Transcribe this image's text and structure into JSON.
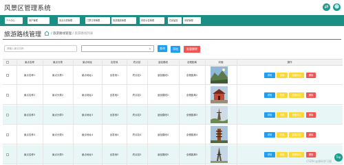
{
  "app": {
    "title": "风景区管理系统"
  },
  "nav": [
    "个人中心",
    "用户管理",
    "景点分类管理",
    "门票订单管理",
    "旅游路线管理",
    "系统公告管理",
    "在线留言",
    "系统管理"
  ],
  "page": {
    "title": "旅游路线管理",
    "breadcrumb": {
      "parent": "旅游路线管理",
      "sep": "/",
      "current": "旅游路线列表"
    }
  },
  "toolbar": {
    "search_placeholder": "请输入景点名称",
    "select_value": "",
    "query_label": "查询",
    "add_label": "添加",
    "batch_delete_label": "批量删除"
  },
  "colors": {
    "nav": "#1b8f84",
    "query": "#1e9ff2",
    "add": "#1e9ff2",
    "batch_delete": "#f25454",
    "view": "#1e9ff2",
    "edit": "#fdd835",
    "comment": "#fdd835",
    "delete": "#f25454"
  },
  "table": {
    "headers": [
      "景点名称",
      "景点分类",
      "景点地址",
      "出发地",
      "终点站",
      "途径路段",
      "全程距离",
      "封面",
      "操作"
    ],
    "rows": [
      [
        "景点名称1",
        "景点分类1",
        "景点地址1",
        "出发地1",
        "终点站1",
        "途径路段1",
        "全程距离1"
      ],
      [
        "景点名称2",
        "景点分类2",
        "景点地址2",
        "出发地2",
        "终点站2",
        "途径路段2",
        "全程距离2"
      ],
      [
        "景点名称3",
        "景点分类3",
        "景点地址3",
        "出发地3",
        "终点站3",
        "途径路段3",
        "全程距离3"
      ],
      [
        "景点名称4",
        "景点分类4",
        "景点地址4",
        "出发地4",
        "终点站4",
        "途径路段4",
        "全程距离4"
      ],
      [
        "景点名称5",
        "景点分类5",
        "景点地址5",
        "出发地5",
        "终点站5",
        "途径路段5",
        "全程距离5"
      ]
    ],
    "actions": [
      "详情",
      "修改",
      "查看评论",
      "删除"
    ]
  },
  "footer": {
    "watermark": "CSDN @源码学习屋",
    "float": "Top"
  }
}
